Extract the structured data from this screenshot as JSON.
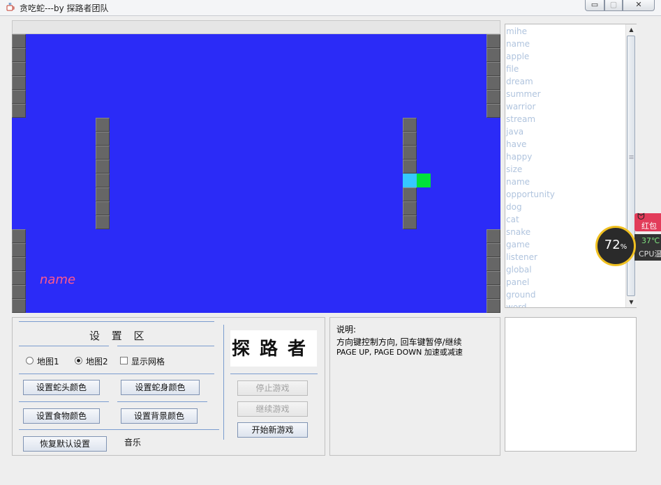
{
  "window": {
    "title": "贪吃蛇---by 探路者团队",
    "min_label": "▭",
    "max_label": "▢",
    "close_label": "✕"
  },
  "game": {
    "background": "#2b2bf7",
    "head_color": "#35c8ff",
    "food_color": "#00e13a",
    "player_name": "name"
  },
  "word_list": {
    "words": [
      "mihe",
      "name",
      "apple",
      "file",
      "dream",
      "summer",
      "warrior",
      "stream",
      "java",
      "have",
      "happy",
      "size",
      "name",
      "opportunity",
      "dog",
      "cat",
      "snake",
      "game",
      "listener",
      "global",
      "panel",
      "ground",
      "word"
    ]
  },
  "settings": {
    "title": "设 置 区",
    "map1_label": "地图1",
    "map2_label": "地图2",
    "show_grid_label": "显示网格",
    "snake_head_color_button": "设置蛇头颜色",
    "snake_body_color_button": "设置蛇身颜色",
    "food_color_button": "设置食物颜色",
    "background_color_button": "设置背景颜色",
    "restore_default_button": "恢复默认设置",
    "music_label": "音乐",
    "logo_text": "探路者",
    "stop_game_button": "停止游戏",
    "continue_game_button": "继续游戏",
    "new_game_button": "开始新游戏"
  },
  "description": {
    "title": "说明:",
    "line1": "方向键控制方向, 回车键暂停/继续",
    "line2": "PAGE UP, PAGE DOWN 加速或减速"
  },
  "cpu_widget": {
    "percent": "72",
    "percent_unit": "%",
    "temperature": "37℃",
    "label": "CPU温",
    "redbag_label": "红包"
  }
}
